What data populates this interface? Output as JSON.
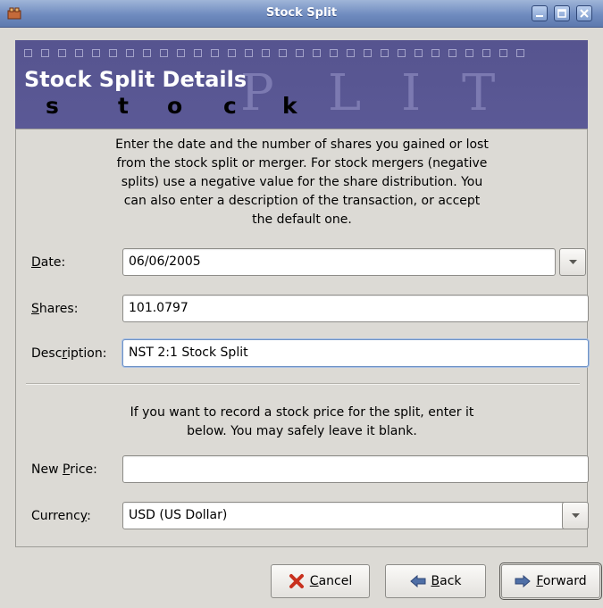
{
  "window": {
    "title": "Stock Split"
  },
  "banner": {
    "title": "Stock Split Details",
    "big_letters": [
      "P",
      "L",
      "I",
      "T"
    ],
    "deco_letters": [
      "s",
      "t",
      "o",
      "c",
      "k"
    ]
  },
  "intro_text": "Enter the date and the number of shares you gained or lost from the stock split or merger. For stock mergers (negative splits) use a negative value for the share distribution. You can also enter a description of the transaction, or accept the default one.",
  "fields": {
    "date": {
      "label_pre": "",
      "label_mnemonic": "D",
      "label_post": "ate:",
      "value": "06/06/2005"
    },
    "shares": {
      "label_pre": "",
      "label_mnemonic": "S",
      "label_post": "hares:",
      "value": "101.0797"
    },
    "description": {
      "label_pre": "Desc",
      "label_mnemonic": "r",
      "label_post": "iption:",
      "value": "NST 2:1 Stock Split"
    }
  },
  "price_text": "If you want to record a stock price for the split, enter it below. You may safely leave it blank.",
  "price_fields": {
    "new_price": {
      "label_pre": "New ",
      "label_mnemonic": "P",
      "label_post": "rice:",
      "value": ""
    },
    "currency": {
      "label_pre": "Currenc",
      "label_mnemonic": "y",
      "label_post": ":",
      "value": "USD (US Dollar)"
    }
  },
  "buttons": {
    "cancel": {
      "pre": "",
      "mnemonic": "C",
      "post": "ancel"
    },
    "back": {
      "pre": "",
      "mnemonic": "B",
      "post": "ack"
    },
    "forward": {
      "pre": "",
      "mnemonic": "F",
      "post": "orward"
    }
  },
  "colors": {
    "banner": "#5a5896",
    "titlebar": "#6f8bbf",
    "focus": "#6f93c6"
  }
}
